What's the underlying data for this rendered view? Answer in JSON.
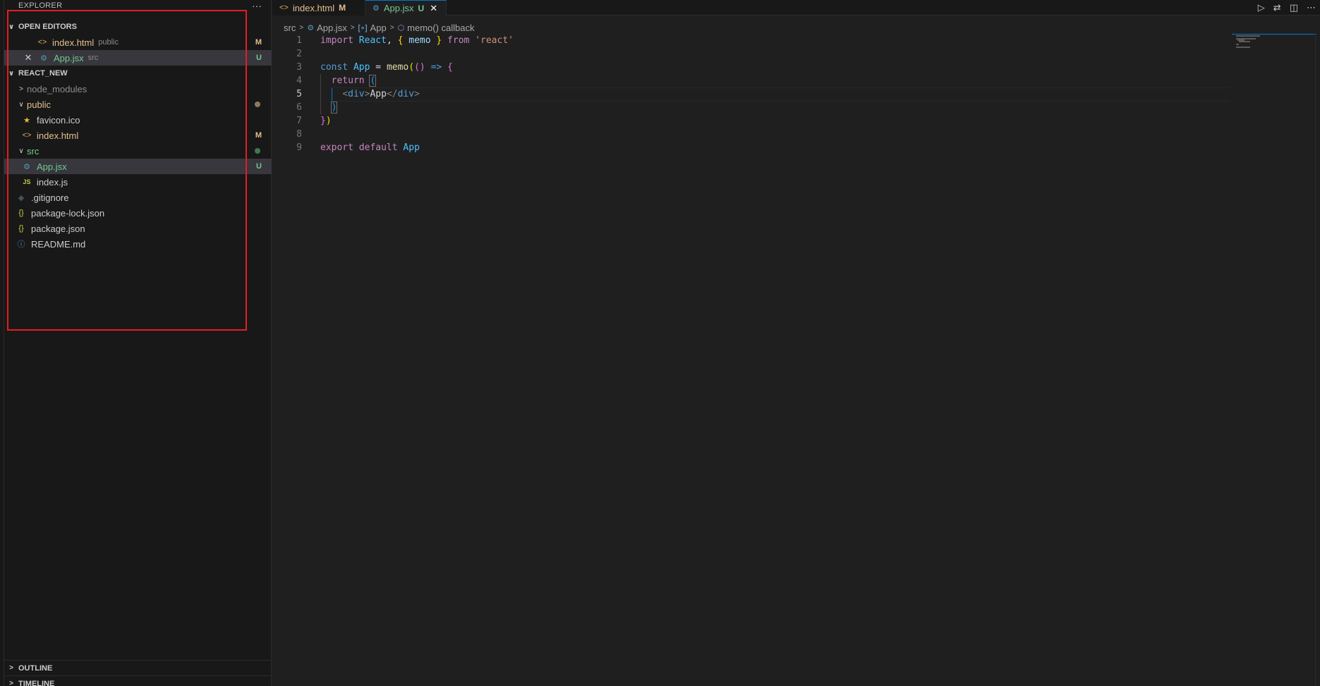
{
  "sidebar": {
    "title": "EXPLORER",
    "more": "···",
    "open_editors": {
      "header": "OPEN EDITORS",
      "items": [
        {
          "label": "index.html",
          "desc": "public",
          "status": "M"
        },
        {
          "label": "App.jsx",
          "desc": "src",
          "status": "U"
        }
      ]
    },
    "project": {
      "header": "REACT_NEW",
      "items": [
        {
          "label": "node_modules"
        },
        {
          "label": "public"
        },
        {
          "label": "favicon.ico"
        },
        {
          "label": "index.html",
          "status": "M"
        },
        {
          "label": "src"
        },
        {
          "label": "App.jsx",
          "status": "U"
        },
        {
          "label": "index.js"
        },
        {
          "label": ".gitignore"
        },
        {
          "label": "package-lock.json"
        },
        {
          "label": "package.json"
        },
        {
          "label": "README.md"
        }
      ]
    },
    "outline": "OUTLINE",
    "timeline": "TIMELINE"
  },
  "tabs": [
    {
      "label": "index.html",
      "status": "M"
    },
    {
      "label": "App.jsx",
      "status": "U"
    }
  ],
  "breadcrumb": {
    "folder": "src",
    "file": "App.jsx",
    "symbol": "App",
    "callback": "memo() callback"
  },
  "editor": {
    "line_numbers": [
      "1",
      "2",
      "3",
      "4",
      "5",
      "6",
      "7",
      "8",
      "9"
    ],
    "current_line": 5,
    "tokens": {
      "l1": {
        "import": "import",
        "react": "React",
        "comma": ",",
        "ob": "{",
        "memo": "memo",
        "cb": "}",
        "from": "from",
        "str": "'react'"
      },
      "l3": {
        "const": "const",
        "app": "App",
        "eq": "=",
        "memo": "memo",
        "op": "(",
        "args": "()",
        "arrow": "=>",
        "ob": "{"
      },
      "l4": {
        "ret": "return",
        "op": "("
      },
      "l5": {
        "lt1": "<",
        "div1": "div",
        "gt1": ">",
        "text": "App",
        "lt2": "</",
        "div2": "div",
        "gt2": ">"
      },
      "l6": {
        "cp": ")"
      },
      "l7": {
        "cb": "}",
        "cp": ")"
      },
      "l9": {
        "export": "export",
        "default": "default",
        "app": "App"
      }
    }
  }
}
